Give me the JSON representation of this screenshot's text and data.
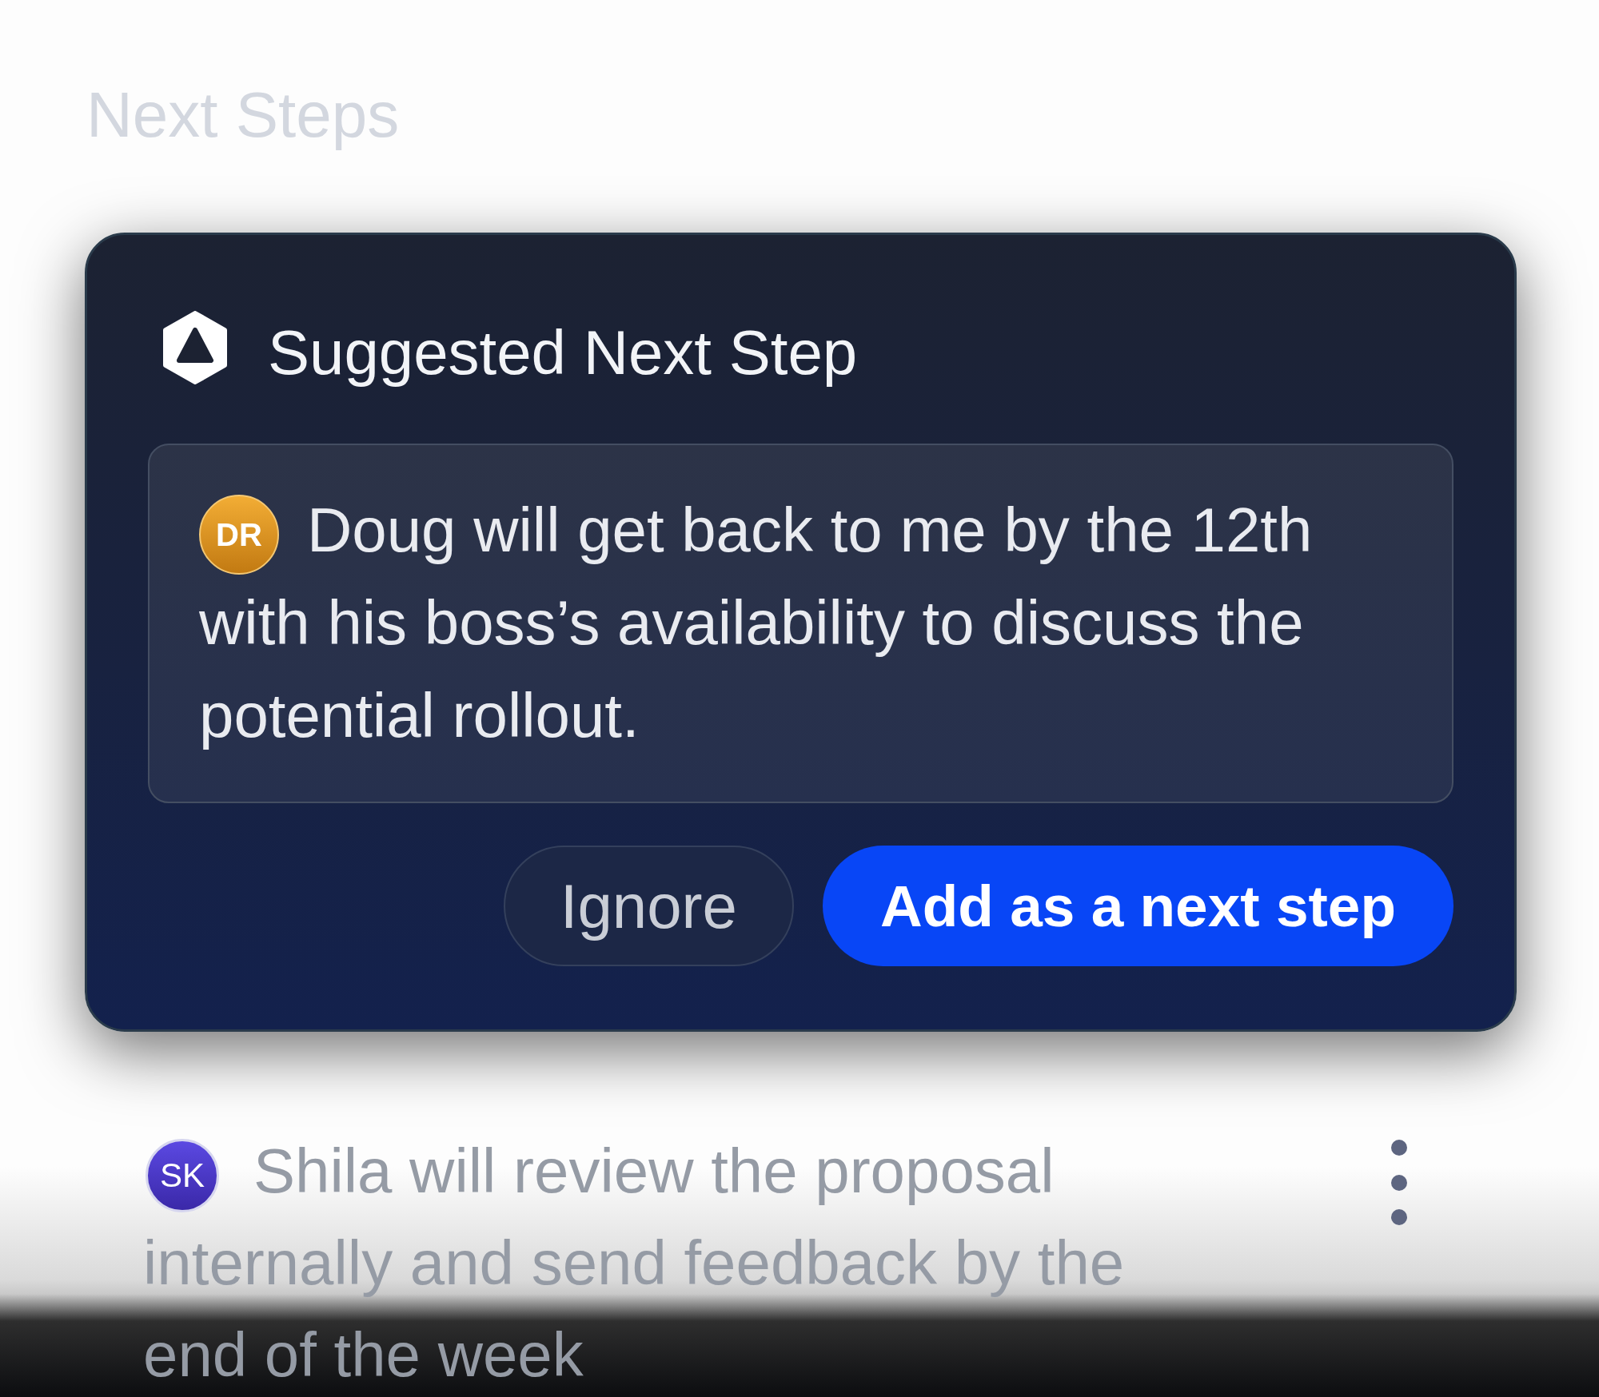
{
  "section": {
    "title": "Next Steps"
  },
  "suggestion_card": {
    "title": "Suggested Next Step",
    "suggestion": {
      "initials": "DR",
      "text": "Doug will get back to me by the 12th with his boss’s availability to discuss the potential rollout."
    },
    "buttons": [
      {
        "label": "Ignore",
        "kind": "secondary"
      },
      {
        "label": "Add as a next step",
        "kind": "primary"
      }
    ]
  },
  "next_steps": [
    {
      "initials": "SK",
      "text": "Shila will review the proposal internally and send feedback by the end of the week"
    }
  ]
}
